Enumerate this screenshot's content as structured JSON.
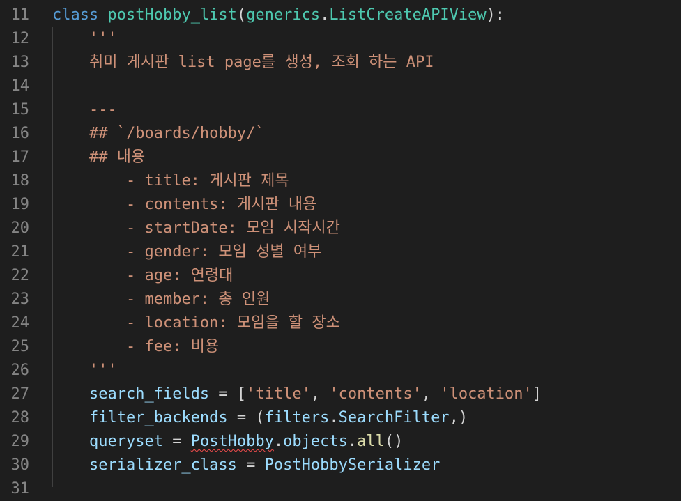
{
  "editor": {
    "lines": [
      {
        "num": "11",
        "indent": "",
        "parts": [
          {
            "text": "class",
            "cls": "kw"
          },
          {
            "text": " ",
            "cls": ""
          },
          {
            "text": "postHobby_list",
            "cls": "cls"
          },
          {
            "text": "(",
            "cls": ""
          },
          {
            "text": "generics",
            "cls": "cls"
          },
          {
            "text": ".",
            "cls": ""
          },
          {
            "text": "ListCreateAPIView",
            "cls": "cls"
          },
          {
            "text": "):",
            "cls": ""
          }
        ]
      },
      {
        "num": "12",
        "indent": "    ",
        "parts": [
          {
            "text": "'''",
            "cls": "str"
          }
        ]
      },
      {
        "num": "13",
        "indent": "    ",
        "parts": [
          {
            "text": "취미 게시판 list page를 생성, 조회 하는 API",
            "cls": "str"
          }
        ]
      },
      {
        "num": "14",
        "indent": "",
        "parts": []
      },
      {
        "num": "15",
        "indent": "    ",
        "parts": [
          {
            "text": "---",
            "cls": "str"
          }
        ]
      },
      {
        "num": "16",
        "indent": "    ",
        "parts": [
          {
            "text": "## `/boards/hobby/`",
            "cls": "str"
          }
        ]
      },
      {
        "num": "17",
        "indent": "    ",
        "parts": [
          {
            "text": "## 내용",
            "cls": "str"
          }
        ]
      },
      {
        "num": "18",
        "indent": "        ",
        "parts": [
          {
            "text": "- title: 게시판 제목",
            "cls": "str"
          }
        ]
      },
      {
        "num": "19",
        "indent": "        ",
        "parts": [
          {
            "text": "- contents: 게시판 내용",
            "cls": "str"
          }
        ]
      },
      {
        "num": "20",
        "indent": "        ",
        "parts": [
          {
            "text": "- startDate: 모임 시작시간",
            "cls": "str"
          }
        ]
      },
      {
        "num": "21",
        "indent": "        ",
        "parts": [
          {
            "text": "- gender: 모임 성별 여부",
            "cls": "str"
          }
        ]
      },
      {
        "num": "22",
        "indent": "        ",
        "parts": [
          {
            "text": "- age: 연령대",
            "cls": "str"
          }
        ]
      },
      {
        "num": "23",
        "indent": "        ",
        "parts": [
          {
            "text": "- member: 총 인원",
            "cls": "str"
          }
        ]
      },
      {
        "num": "24",
        "indent": "        ",
        "parts": [
          {
            "text": "- location: 모임을 할 장소",
            "cls": "str"
          }
        ]
      },
      {
        "num": "25",
        "indent": "        ",
        "parts": [
          {
            "text": "- fee: 비용",
            "cls": "str"
          }
        ]
      },
      {
        "num": "26",
        "indent": "    ",
        "parts": [
          {
            "text": "'''",
            "cls": "str"
          }
        ]
      },
      {
        "num": "27",
        "indent": "    ",
        "parts": [
          {
            "text": "search_fields",
            "cls": "var"
          },
          {
            "text": " = [",
            "cls": ""
          },
          {
            "text": "'title'",
            "cls": "str"
          },
          {
            "text": ", ",
            "cls": ""
          },
          {
            "text": "'contents'",
            "cls": "str"
          },
          {
            "text": ", ",
            "cls": ""
          },
          {
            "text": "'location'",
            "cls": "str"
          },
          {
            "text": "]",
            "cls": ""
          }
        ]
      },
      {
        "num": "28",
        "indent": "    ",
        "parts": [
          {
            "text": "filter_backends",
            "cls": "var"
          },
          {
            "text": " = (",
            "cls": ""
          },
          {
            "text": "filters",
            "cls": "var"
          },
          {
            "text": ".",
            "cls": ""
          },
          {
            "text": "SearchFilter",
            "cls": "var"
          },
          {
            "text": ",)",
            "cls": ""
          }
        ]
      },
      {
        "num": "29",
        "indent": "    ",
        "parts": [
          {
            "text": "queryset",
            "cls": "var"
          },
          {
            "text": " = ",
            "cls": ""
          },
          {
            "text": "PostHobby",
            "cls": "var squiggle"
          },
          {
            "text": ".",
            "cls": ""
          },
          {
            "text": "objects",
            "cls": "var"
          },
          {
            "text": ".",
            "cls": ""
          },
          {
            "text": "all",
            "cls": "fn"
          },
          {
            "text": "()",
            "cls": ""
          }
        ]
      },
      {
        "num": "30",
        "indent": "    ",
        "parts": [
          {
            "text": "serializer_class",
            "cls": "var"
          },
          {
            "text": " = ",
            "cls": ""
          },
          {
            "text": "PostHobbySerializer",
            "cls": "var"
          }
        ]
      },
      {
        "num": "31",
        "indent": "",
        "parts": []
      }
    ]
  },
  "colors": {
    "background": "#1e1e1e",
    "line_number": "#858585",
    "keyword": "#569cd6",
    "class_name": "#4ec9b0",
    "string": "#ce9178",
    "variable": "#9cdcfe",
    "function": "#dcdcaa",
    "default": "#d4d4d4",
    "error_squiggle": "#f14c4c"
  }
}
